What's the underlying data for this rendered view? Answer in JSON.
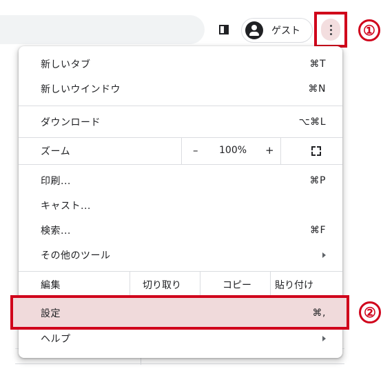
{
  "toolbar": {
    "profile_name": "ゲスト",
    "step1_marker": "①",
    "step2_marker": "②"
  },
  "menu": {
    "new_tab": {
      "label": "新しいタブ",
      "shortcut": "⌘T"
    },
    "new_window": {
      "label": "新しいウインドウ",
      "shortcut": "⌘N"
    },
    "downloads": {
      "label": "ダウンロード",
      "shortcut": "⌥⌘L"
    },
    "zoom": {
      "label": "ズーム",
      "minus": "–",
      "value": "100%",
      "plus": "+"
    },
    "print": {
      "label": "印刷...",
      "shortcut": "⌘P"
    },
    "cast": {
      "label": "キャスト..."
    },
    "find": {
      "label": "検索...",
      "shortcut": "⌘F"
    },
    "more_tools": {
      "label": "その他のツール"
    },
    "edit": {
      "label": "編集",
      "cut": "切り取り",
      "copy": "コピー",
      "paste": "貼り付け"
    },
    "settings": {
      "label": "設定",
      "shortcut": "⌘,"
    },
    "help": {
      "label": "ヘルプ"
    }
  },
  "colors": {
    "highlight_red": "#d0021b",
    "settings_hover": "#f0dadb",
    "kebab_hover": "#f3dedf"
  }
}
